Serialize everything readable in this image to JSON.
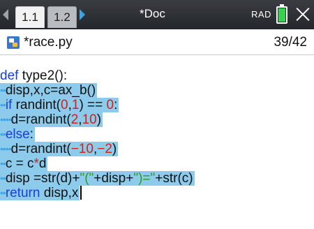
{
  "titlebar": {
    "tabs": [
      {
        "label": "1.1",
        "active": true
      },
      {
        "label": "1.2",
        "active": false
      }
    ],
    "doc_title": "*Doc",
    "mode": "RAD"
  },
  "editor": {
    "filename": "*race.py",
    "position": "39/42"
  },
  "code": {
    "l1_kw": "def",
    "l1_rest": " type2():",
    "l2_ind": "••",
    "l2_text": "disp,x,c=ax_b()",
    "l3_ind": "••",
    "l3_kw": "if",
    "l3_a": " randint(",
    "l3_n1": "0",
    "l3_b": ",",
    "l3_n2": "1",
    "l3_c": ") == ",
    "l3_n3": "0",
    "l3_d": ":",
    "l4_ind": "••••",
    "l4_a": "d=randint(",
    "l4_n1": "2",
    "l4_b": ",",
    "l4_n2": "10",
    "l4_c": ")",
    "l5_ind": "••",
    "l5_kw": "else",
    "l5_rest": ":",
    "l6_ind": "••••",
    "l6_a": "d=randint(",
    "l6_n1": "−10",
    "l6_b": ",",
    "l6_n2": "−2",
    "l6_c": ")",
    "l7_ind": "••",
    "l7_a": "c = c",
    "l7_op": "*",
    "l7_b": "d",
    "l8_ind": "••",
    "l8_a": "disp =str(d)+",
    "l8_s1": "\"(\"",
    "l8_b": "+disp+",
    "l8_s2": "\")=\"",
    "l8_c": "+str(c)",
    "l9_ind": "••",
    "l9_kw": "return",
    "l9_rest": " disp,x"
  },
  "colors": {
    "selection": "#8ccbec",
    "keyword": "#1a3fd6",
    "number": "#d1201a",
    "string": "#2f9a1e"
  }
}
